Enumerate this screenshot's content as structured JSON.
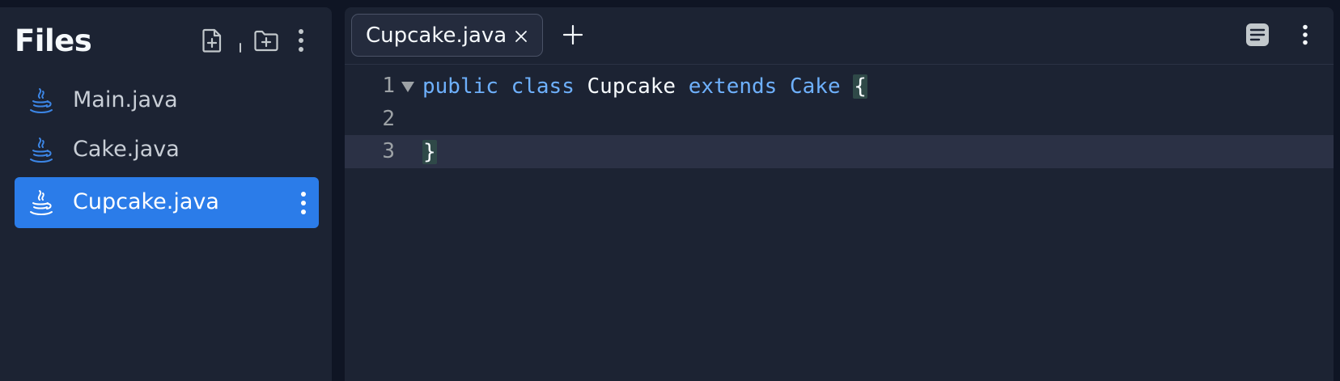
{
  "sidebar": {
    "title": "Files",
    "files": [
      {
        "name": "Main.java",
        "active": false
      },
      {
        "name": "Cake.java",
        "active": false
      },
      {
        "name": "Cupcake.java",
        "active": true
      }
    ]
  },
  "editor": {
    "tab": {
      "label": "Cupcake.java"
    },
    "lines": [
      {
        "number": "1",
        "tokens": [
          "public",
          "class",
          "Cupcake",
          "extends",
          "Cake",
          "{"
        ]
      },
      {
        "number": "2",
        "tokens": []
      },
      {
        "number": "3",
        "tokens": [
          "}"
        ]
      }
    ]
  },
  "colors": {
    "background": "#0f1524",
    "panel": "#1c2333",
    "active_file": "#2b7ce9",
    "keyword": "#6eb0fc",
    "text": "#f5f9fc",
    "current_line": "#2b3145",
    "bracket_match": "#2f4948"
  },
  "icons": {
    "new_file": "new-file-icon",
    "new_folder": "new-folder-icon",
    "more": "kebab-menu-icon",
    "java": "java-file-icon",
    "close": "close-icon",
    "add_tab": "plus-icon",
    "format": "format-icon"
  }
}
